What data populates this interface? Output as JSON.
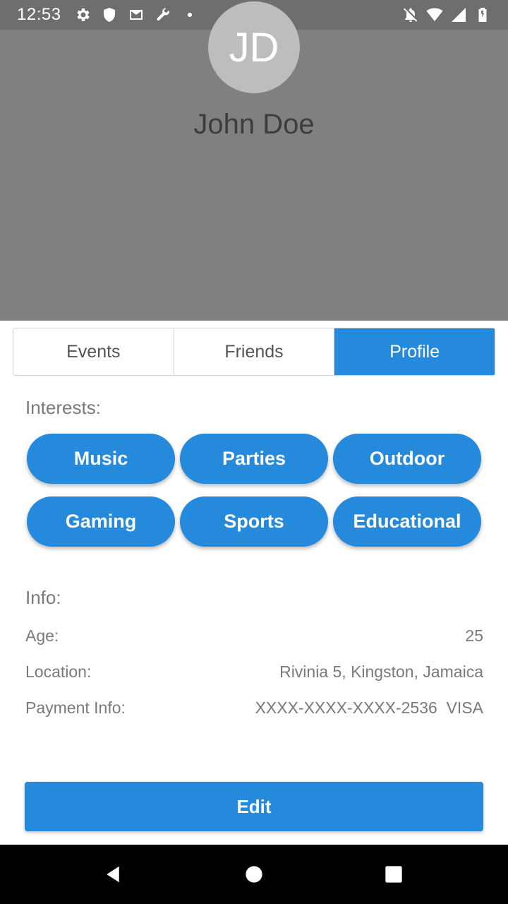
{
  "status_bar": {
    "time": "12:53",
    "icons_left": [
      "gear-icon",
      "shield-icon",
      "mail-icon",
      "wrench-icon",
      "dot-icon"
    ],
    "icons_right": [
      "notifications-off-icon",
      "wifi-icon",
      "signal-icon",
      "battery-icon"
    ]
  },
  "profile": {
    "initials": "JD",
    "name": "John Doe"
  },
  "tabs": [
    {
      "label": "Events",
      "active": false
    },
    {
      "label": "Friends",
      "active": false
    },
    {
      "label": "Profile",
      "active": true
    }
  ],
  "interests": {
    "title": "Interests:",
    "items": [
      "Music",
      "Parties",
      "Outdoor",
      "Gaming",
      "Sports",
      "Educational"
    ]
  },
  "info": {
    "title": "Info:",
    "rows": [
      {
        "label": "Age:",
        "value": "25"
      },
      {
        "label": "Location:",
        "value": "Rivinia 5, Kingston, Jamaica"
      },
      {
        "label": "Payment Info:",
        "value": "XXXX-XXXX-XXXX-2536  VISA"
      }
    ]
  },
  "actions": {
    "edit_label": "Edit"
  },
  "colors": {
    "accent": "#2589dc",
    "header_bg": "#808080",
    "status_bg": "#6e6e6e"
  },
  "nav_bar": {
    "buttons": [
      "back-icon",
      "home-icon",
      "recents-icon"
    ]
  }
}
